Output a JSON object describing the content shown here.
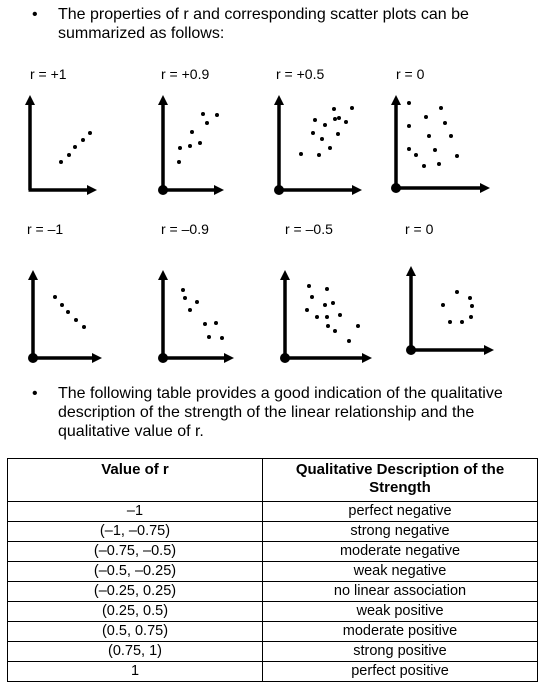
{
  "bullets": [
    "The properties of r and corresponding scatter plots can be summarized as follows:",
    "The following table provides a good indication of the qualitative description of the strength of the linear relationship and the qualitative value of r."
  ],
  "bullet_symbol": "•",
  "plot_labels": [
    "r = +1",
    "r = +0.9",
    "r = +0.5",
    "r = 0",
    "r = –1",
    "r = –0.9",
    "r = –0.5",
    "r = 0"
  ],
  "table": {
    "headers": [
      "Value of r",
      "Qualitative Description of the Strength"
    ],
    "rows": [
      [
        "–1",
        "perfect negative"
      ],
      [
        "(–1, –0.75)",
        "strong negative"
      ],
      [
        "(–0.75, –0.5)",
        "moderate negative"
      ],
      [
        "(–0.5, –0.25)",
        "weak negative"
      ],
      [
        "(–0.25, 0.25)",
        "no linear association"
      ],
      [
        "(0.25, 0.5)",
        "weak positive"
      ],
      [
        "(0.5, 0.75)",
        "moderate positive"
      ],
      [
        "(0.75, 1)",
        "strong positive"
      ],
      [
        "1",
        "perfect positive"
      ]
    ]
  }
}
